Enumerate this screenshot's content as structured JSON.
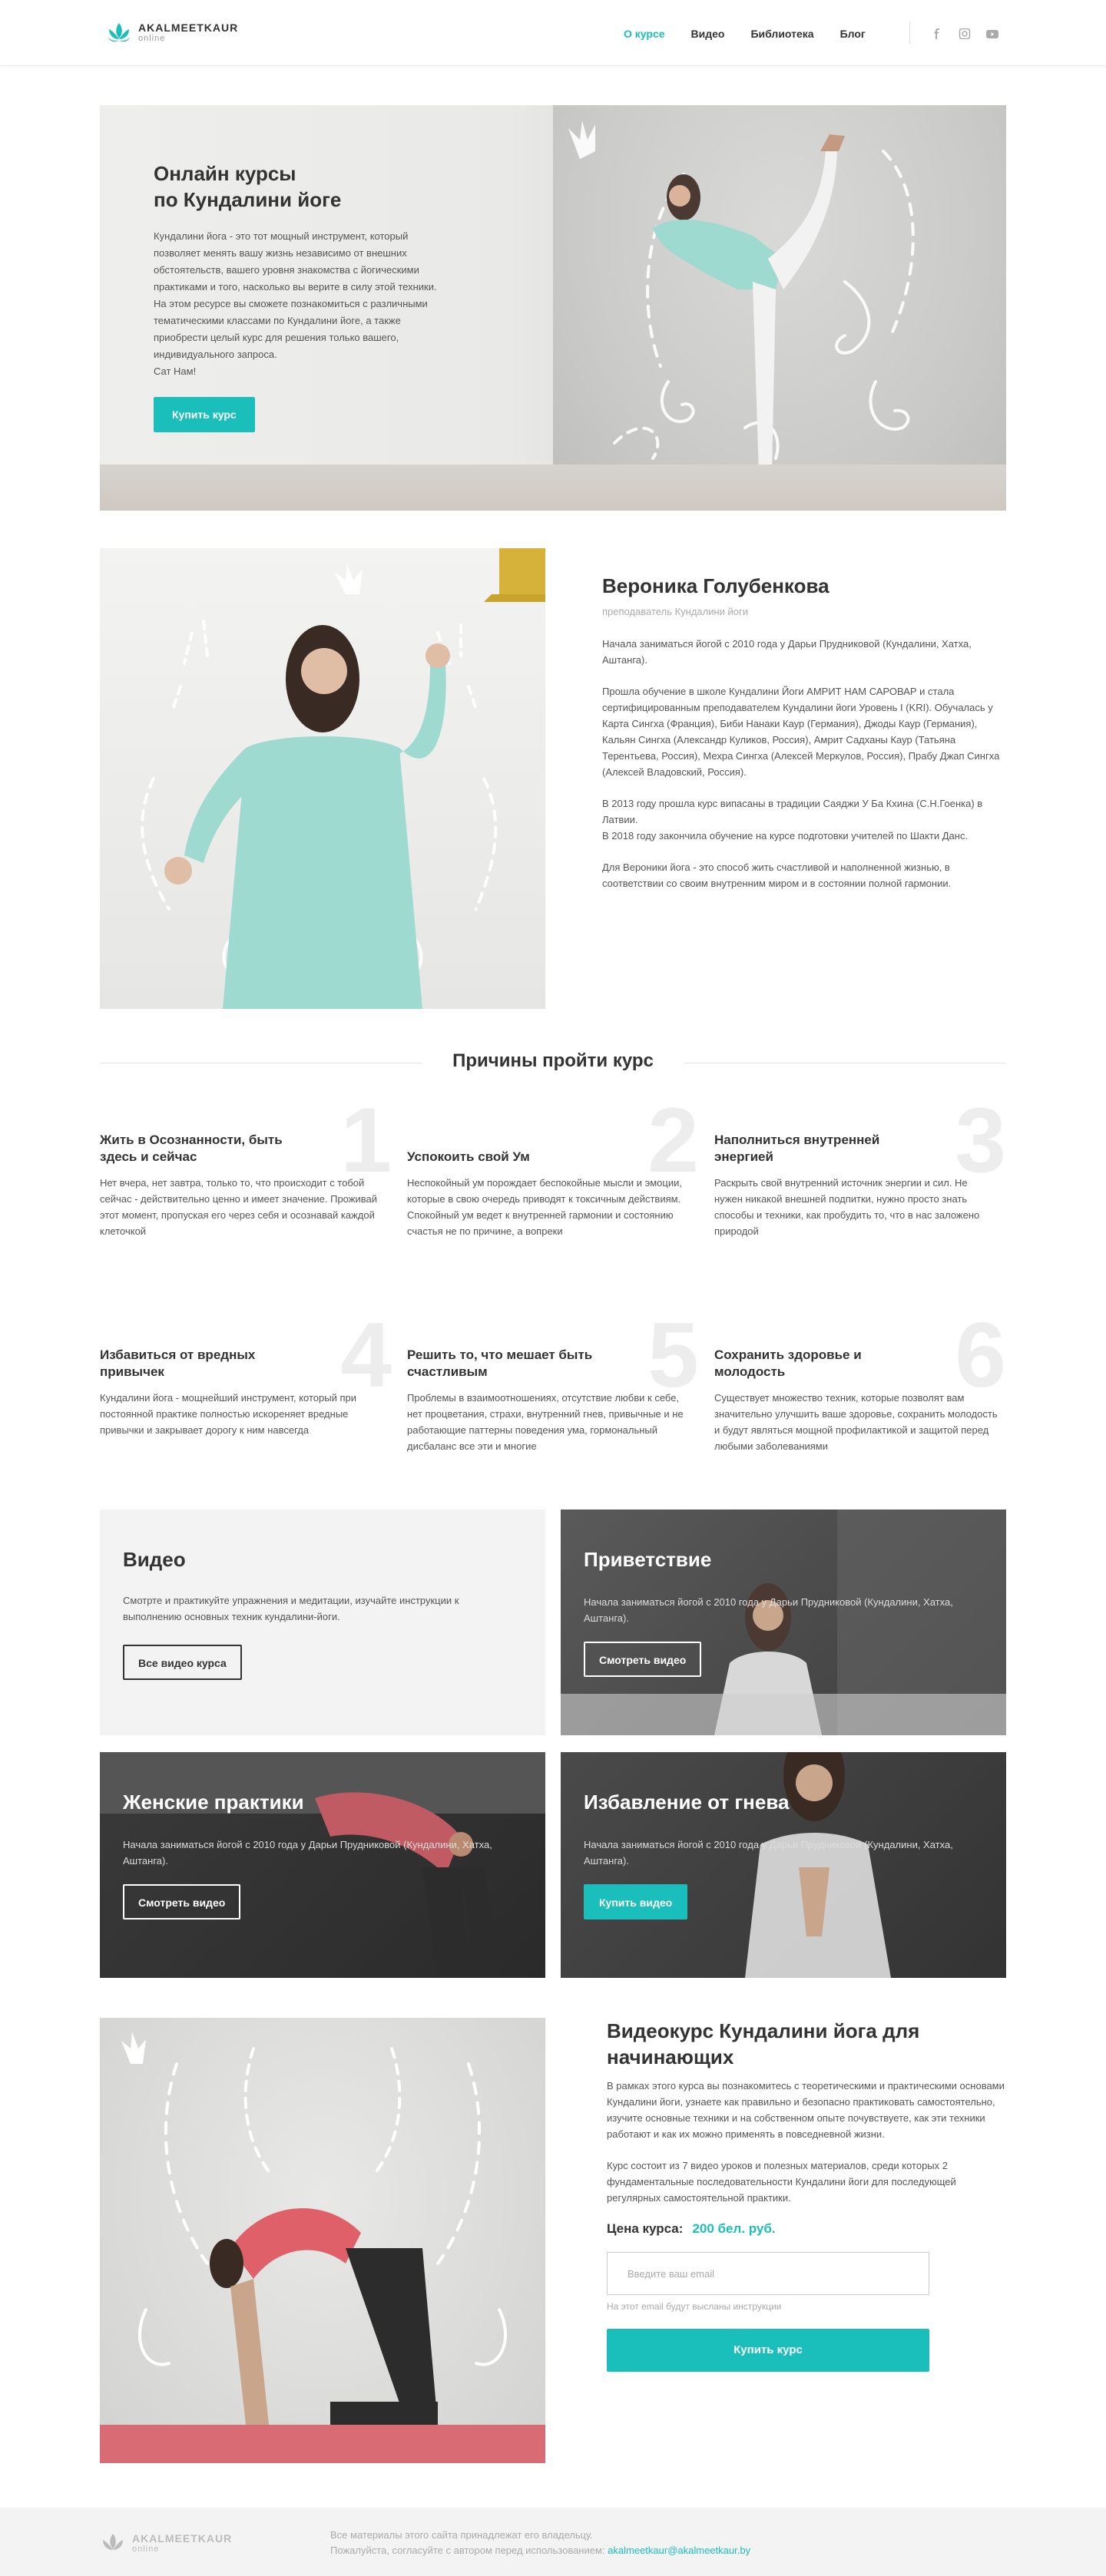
{
  "brand": {
    "name": "AKALMEETKAUR",
    "sub": "online"
  },
  "nav": [
    {
      "label": "О курсе"
    },
    {
      "label": "Видео"
    },
    {
      "label": "Библиотека"
    },
    {
      "label": "Блог"
    }
  ],
  "socials": [
    "facebook-icon",
    "instagram-icon",
    "youtube-icon"
  ],
  "hero": {
    "title_line1": "Онлайн курсы",
    "title_line2": "по Кундалини йоге",
    "body": "Кундалини йога - это тот мощный инструмент, который\nпозволяет менять вашу жизнь независимо от внешних\nобстоятельств, вашего уровня знакомства с йогическими\nпрактиками и того, насколько вы верите в силу этой техники.\nНа этом ресурсе вы сможете познакомиться с различными\nтематическими классами по Кундалини йоге, а также\nприобрести целый курс для решения только вашего,\nиндивидуального запроса.\nСат Нам!",
    "button": "Купить курс"
  },
  "instructor": {
    "name": "Вероника Голубенкова",
    "role": "преподаватель Кундалини йоги",
    "bio": [
      "Начала заниматься йогой с 2010 года у Дарьи Прудниковой (Кундалини, Хатха, Аштанга).",
      "Прошла обучение в школе Кундалини Йоги АМРИТ НАМ САРОВАР и стала сертифицированным преподавателем Кундалини йоги Уровень I (KRI). Обучалась у Карта Сингха (Франция), Биби Нанаки Каур (Германия), Джоды Каур (Германия), Кальян Сингха (Александр Куликов, Россия), Амрит Садханы Каур (Татьяна Терентьева, Россия), Мехра Сингха (Алексей Меркулов, Россия), Прабу Джап Сингха (Алексей Владовский, Россия).",
      "В 2013 году прошла курс випасаны в традиции Саяджи У Ба Кхина (С.Н.Гоенка) в Латвии.\nВ 2018 году закончила обучение на курсе подготовки учителей по Шакти Данс.",
      "Для Вероники йога - это способ жить счастливой и наполненной жизнью, в соответствии со своим внутренним миром и в состоянии полной гармонии."
    ]
  },
  "reasons": {
    "title": "Причины пройти курс",
    "items": [
      {
        "num": "1",
        "title": "Жить в Осознанности, быть здесь и сейчас",
        "text": "Нет вчера, нет завтра, только то, что происходит с тобой сейчас - действительно ценно и имеет значение. Проживай этот момент, пропуская его через себя и осознавай каждой клеточкой"
      },
      {
        "num": "2",
        "title": "Успокоить свой Ум",
        "text": "Неспокойный ум порождает беспокойные мысли и эмоции, которые в свою очередь приводят к токсичным действиям. Спокойный ум ведет к внутренней гармонии и состоянию счастья не по причине, а вопреки"
      },
      {
        "num": "3",
        "title": "Наполниться внутренней энергией",
        "text": "Раскрыть свой внутренний источник энергии и сил. Не нужен никакой внешней подпитки, нужно просто знать способы и техники, как пробудить то, что в нас заложено природой"
      },
      {
        "num": "4",
        "title": "Избавиться от вредных привычек",
        "text": "Кундалини йога - мощнейший инструмент, который при постоянной практике полностью искореняет вредные привычки и закрывает дорогу к ним навсегда"
      },
      {
        "num": "5",
        "title": "Решить то, что мешает быть счастливым",
        "text": "Проблемы в взаимоотношениях, отсутствие любви к себе, нет процветания, страхи, внутренний гнев, привычные и не работающие паттерны поведения ума, гормональный дисбаланс все эти и многие"
      },
      {
        "num": "6",
        "title": "Сохранить здоровье и молодость",
        "text": "Существует множество техник, которые позволят вам значительно улучшить ваше здоровье, сохранить молодость и будут являться мощной профилактикой и защитой перед любыми заболеваниями"
      }
    ]
  },
  "videos": {
    "intro": {
      "title": "Видео",
      "text": "Смотрте и практикуйте упражнения и медитации, изучайте инструкции к выполнению основных техник кундалини-йоги.",
      "button": "Все видео курса"
    },
    "cards": [
      {
        "title": "Приветствие",
        "text": "Начала заниматься йогой с 2010 года у Дарьи Прудниковой (Кундалини, Хатха, Аштанга).",
        "button": "Смотреть видео"
      },
      {
        "title": "Женские практики",
        "text": "Начала заниматься йогой с 2010 года у Дарьи Прудниковой (Кундалини, Хатха, Аштанга).",
        "button": "Смотреть видео"
      },
      {
        "title": "Избавление от гнева",
        "text": "Начала заниматься йогой с 2010 года у Дарьи Прудниковой (Кундалини, Хатха, Аштанга).",
        "button": "Купить видео"
      }
    ]
  },
  "course": {
    "title": "Видеокурс Кундалини йога для начинающих",
    "desc": [
      "В рамках этого курса вы познакомитесь с теоретическими и практическими основами Кундалини йоги, узнаете как правильно и безопасно практиковать самостоятельно, изучите основные техники и на собственном опыте почувствуете, как эти техники работают и как их можно применять в повседневной жизни.",
      "Курс состоит из 7 видео уроков и полезных материалов, среди которых 2 фундаментальные последовательности Кундалини йоги для последующей регулярных самостоятельной практики."
    ],
    "price_label": "Цена курса:",
    "price": "200 бел. руб.",
    "email_placeholder": "Введите ваш email",
    "email_hint": "На этот email будут высланы инструкции",
    "button": "Купить курс"
  },
  "footer": {
    "line1": "Все материалы этого сайта принадлежат его владельцу.",
    "line2": "Пожалуйста, согласуйте с автором перед использованием:",
    "email": "akalmeetkaur@akalmeetkaur.by"
  },
  "colors": {
    "accent": "#1abfbc",
    "text": "#333333",
    "muted": "#aaaaaa"
  }
}
